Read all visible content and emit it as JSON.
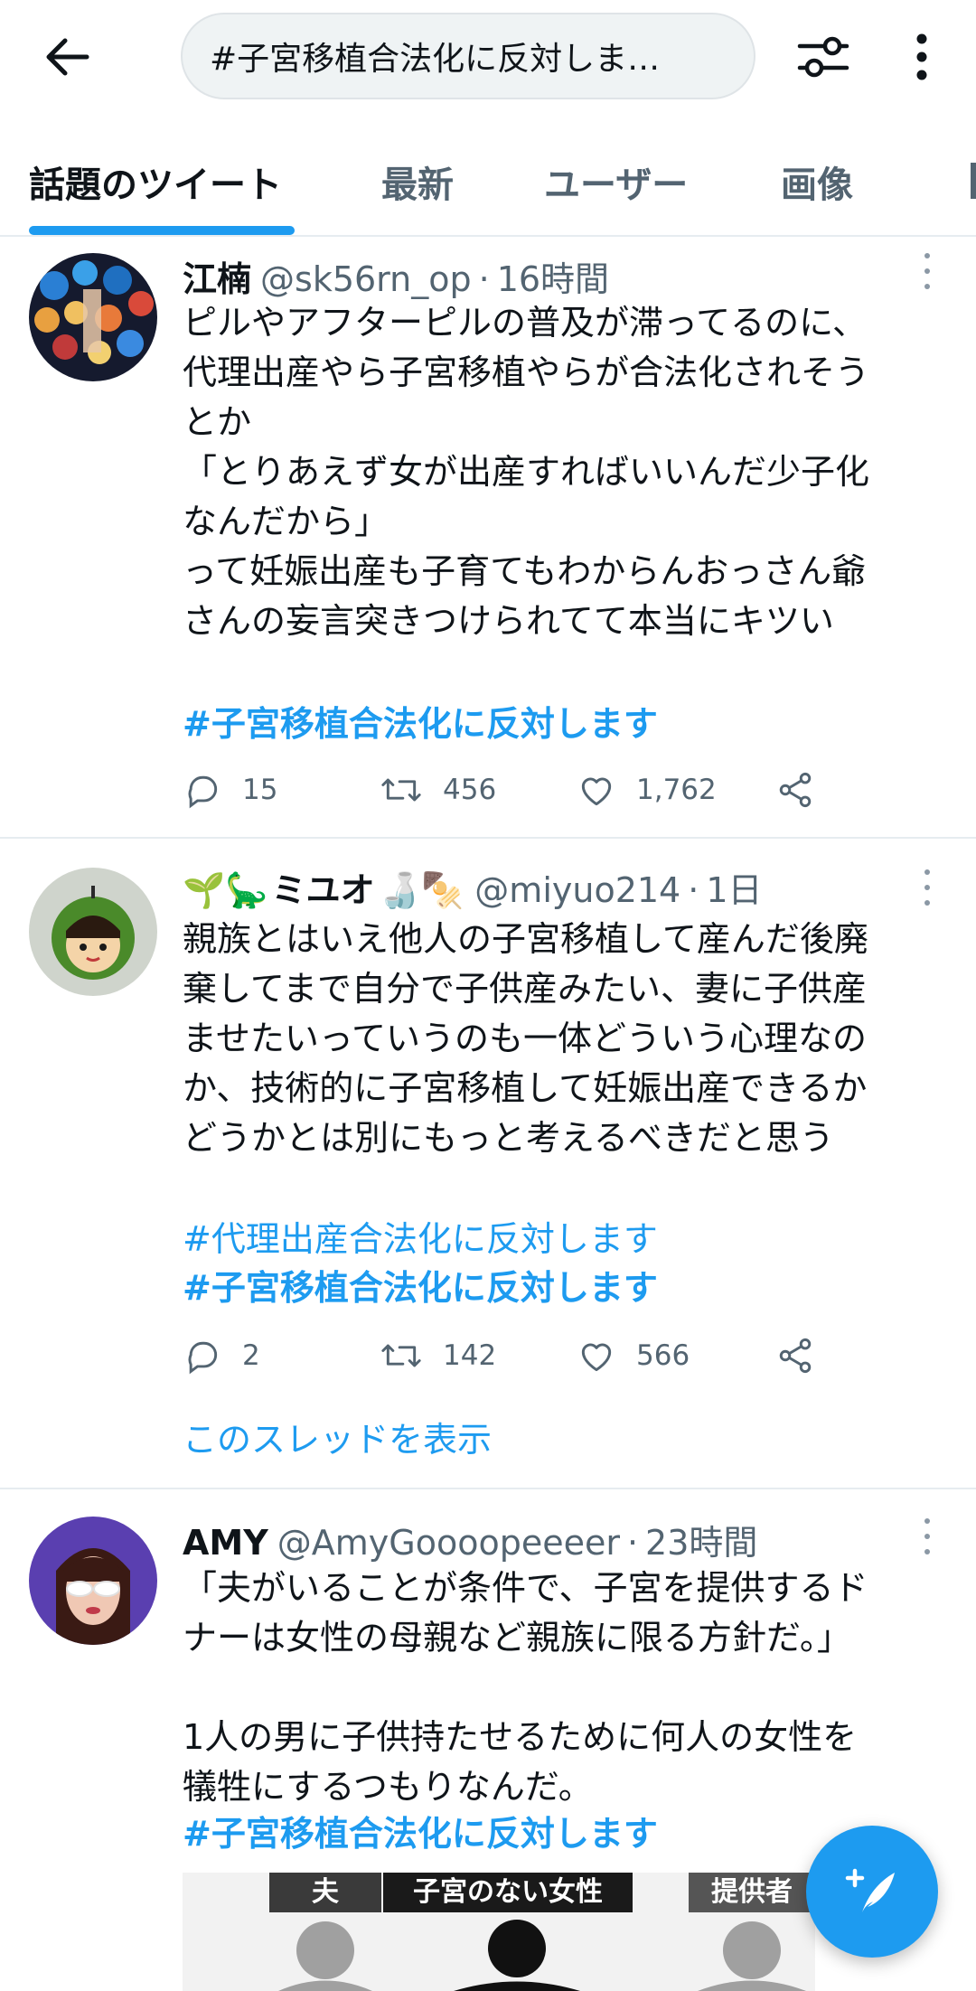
{
  "search": {
    "value": "#子宮移植合法化に反対しま…"
  },
  "tabs": [
    {
      "label": "話題のツイート",
      "active": true
    },
    {
      "label": "最新"
    },
    {
      "label": "ユーザー"
    },
    {
      "label": "画像"
    }
  ],
  "colors": {
    "accent": "#1d9bf0",
    "text": "#0f1419",
    "muted": "#536471"
  },
  "tweets": [
    {
      "name": "江楠",
      "handle": "@sk56rn_op",
      "time": "16時間",
      "text": "ピルやアフターピルの普及が滞ってるのに、\n代理出産やら子宮移植やらが合法化されそう\nとか\n「とりあえず女が出産すればいいんだ少子化\nなんだから」\nって妊娠出産も子育てもわからんおっさん爺\nさんの妄言突きつけられてて本当にキツい",
      "hashtags": [
        "#子宮移植合法化に反対します"
      ],
      "replies": "15",
      "retweets": "456",
      "likes": "1,762"
    },
    {
      "name": "ミユオ",
      "name_emoji_prefix": "🌱🦕",
      "name_emoji_suffix": "🍶🍢",
      "handle": "@miyuo214",
      "time": "1日",
      "text": "親族とはいえ他人の子宮移植して産んだ後廃\n棄してまで自分で子供産みたい、妻に子供産\nませたいっていうのも一体どういう心理なの\nか、技術的に子宮移植して妊娠出産できるか\nどうかとは別にもっと考えるべきだと思う",
      "hashtags": [
        "#代理出産合法化に反対します",
        "#子宮移植合法化に反対します"
      ],
      "replies": "2",
      "retweets": "142",
      "likes": "566",
      "thread_link": "このスレッドを表示"
    },
    {
      "name": "AMY",
      "handle": "@AmyGoooopeeeer",
      "time": "23時間",
      "text": "「夫がいることが条件で、子宮を提供するド\nナーは女性の母親など親族に限る方針だ。」\n\n1人の男に子供持たせるために何人の女性を\n犠牲にするつもりなんだ。",
      "hashtags": [
        "#子宮移植合法化に反対します"
      ],
      "image_labels": [
        "夫",
        "子宮のない女性",
        "提供者"
      ]
    }
  ],
  "icons": {
    "back": "arrow-left-icon",
    "filter": "sliders-icon",
    "more": "more-vertical-icon",
    "reply": "reply-icon",
    "retweet": "retweet-icon",
    "like": "heart-icon",
    "share": "share-icon",
    "compose": "compose-icon"
  }
}
